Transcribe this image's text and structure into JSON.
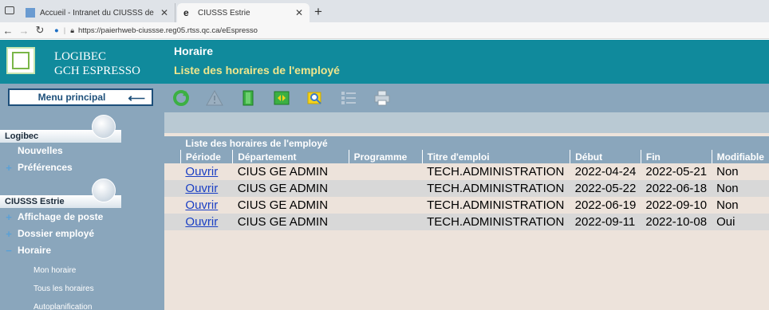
{
  "browser": {
    "tabs": [
      {
        "title": "Accueil - Intranet du CIUSSS de l",
        "active": false
      },
      {
        "title": "CIUSSS Estrie",
        "active": true
      }
    ],
    "url": "https://paierhweb-ciussse.reg05.rtss.qc.ca/eEspresso"
  },
  "app": {
    "logo_line1": "LOGIBEC",
    "logo_line2": "GCH ESPRESSO",
    "header_title": "Horaire",
    "header_subtitle": "Liste des horaires de l'employé",
    "menu_button": "Menu principal"
  },
  "sidebar": {
    "section1": "Logibec",
    "section1_items": [
      "Nouvelles",
      "Préférences"
    ],
    "section2": "CIUSSS Estrie",
    "section2_items": [
      "Affichage de poste",
      "Dossier employé",
      "Horaire"
    ],
    "horaire_subitems": [
      "Mon horaire",
      "Tous les horaires",
      "Autoplanification"
    ]
  },
  "grid": {
    "title": "Liste des horaires de l'employé",
    "columns": [
      "Période",
      "Département",
      "Programme",
      "Titre d'emploi",
      "Début",
      "Fin",
      "Modifiable"
    ],
    "rows": [
      {
        "action": "Ouvrir",
        "departement": "CIUS GE ADMIN",
        "programme": "",
        "titre": "TECH.ADMINISTRATION",
        "debut": "2022-04-24",
        "fin": "2022-05-21",
        "modifiable": "Non"
      },
      {
        "action": "Ouvrir",
        "departement": "CIUS GE ADMIN",
        "programme": "",
        "titre": "TECH.ADMINISTRATION",
        "debut": "2022-05-22",
        "fin": "2022-06-18",
        "modifiable": "Non"
      },
      {
        "action": "Ouvrir",
        "departement": "CIUS GE ADMIN",
        "programme": "",
        "titre": "TECH.ADMINISTRATION",
        "debut": "2022-06-19",
        "fin": "2022-09-10",
        "modifiable": "Non"
      },
      {
        "action": "Ouvrir",
        "departement": "CIUS GE ADMIN",
        "programme": "",
        "titre": "TECH.ADMINISTRATION",
        "debut": "2022-09-11",
        "fin": "2022-10-08",
        "modifiable": "Oui"
      }
    ]
  },
  "toolbar_icons": [
    "refresh-icon",
    "warning-icon",
    "column-icon",
    "expand-icon",
    "search-icon",
    "list-icon",
    "print-icon"
  ],
  "colors": {
    "header": "#108a9c",
    "panel": "#8aa6bc",
    "content": "#ede3db",
    "subtitle": "#f0e68c",
    "link": "#1a3fc4"
  }
}
